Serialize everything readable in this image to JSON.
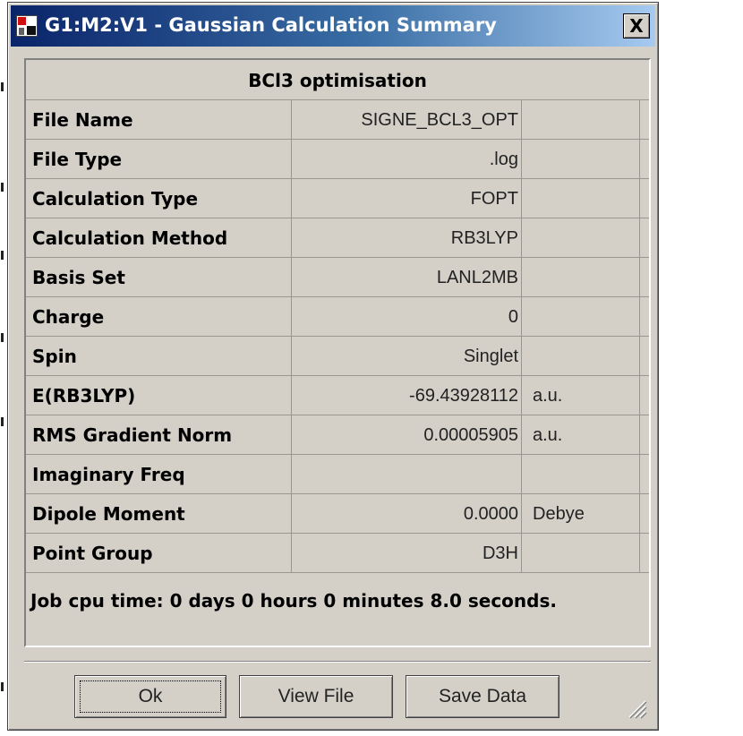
{
  "window": {
    "title": "G1:M2:V1 - Gaussian Calculation Summary",
    "close_symbol": "X"
  },
  "table": {
    "title": "BCl3 optimisation",
    "rows": [
      {
        "label": "File Name",
        "value": "SIGNE_BCL3_OPT",
        "unit": ""
      },
      {
        "label": "File Type",
        "value": ".log",
        "unit": ""
      },
      {
        "label": "Calculation Type",
        "value": "FOPT",
        "unit": ""
      },
      {
        "label": "Calculation Method",
        "value": "RB3LYP",
        "unit": ""
      },
      {
        "label": "Basis Set",
        "value": "LANL2MB",
        "unit": ""
      },
      {
        "label": "Charge",
        "value": "0",
        "unit": ""
      },
      {
        "label": "Spin",
        "value": "Singlet",
        "unit": ""
      },
      {
        "label": "E(RB3LYP)",
        "value": "-69.43928112",
        "unit": "a.u."
      },
      {
        "label": "RMS Gradient Norm",
        "value": "0.00005905",
        "unit": "a.u."
      },
      {
        "label": "Imaginary Freq",
        "value": "",
        "unit": ""
      },
      {
        "label": "Dipole Moment",
        "value": "0.0000",
        "unit": "Debye"
      },
      {
        "label": "Point Group",
        "value": "D3H",
        "unit": ""
      }
    ],
    "cpu_time": "Job cpu time:  0 days  0 hours  0 minutes  8.0 seconds."
  },
  "buttons": {
    "ok": "Ok",
    "view_file": "View File",
    "save_data": "Save Data"
  },
  "icons": {
    "app": "gaussview-app-icon",
    "close": "close-icon",
    "grip": "resize-grip-icon"
  },
  "colors": {
    "titlebar_start": "#0a246a",
    "titlebar_end": "#a6caf0",
    "dialog_face": "#d4d0c8"
  }
}
